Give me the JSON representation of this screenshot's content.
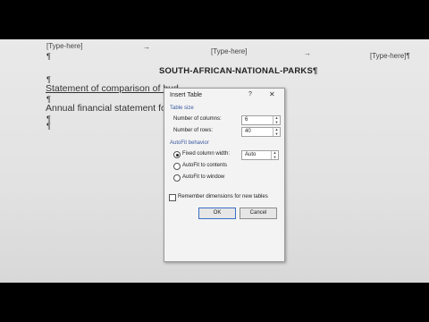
{
  "document": {
    "header_left": "[Type-here]",
    "header_center": "[Type-here]",
    "header_right": "[Type-here]¶",
    "pilcrow": "¶",
    "arrow": "→",
    "title": "SOUTH-AFRICAN-NATIONAL-PARKS¶",
    "line_statement": "Statement of comparison of bud",
    "line_annual": "Annual financial statement for th"
  },
  "dialog": {
    "title": "Insert Table",
    "help": "?",
    "close": "✕",
    "table_size_label": "Table size",
    "columns_label": "Number of columns:",
    "columns_value": "6",
    "rows_label": "Number of rows:",
    "rows_value": "40",
    "autofit_label": "AutoFit behavior",
    "fixed_label": "Fixed column width:",
    "fixed_value": "Auto",
    "autofit_contents_label": "AutoFit to contents",
    "autofit_window_label": "AutoFit to window",
    "remember_label": "Remember dimensions for new tables",
    "ok_label": "OK",
    "cancel_label": "Cancel",
    "selected_autofit": "fixed"
  }
}
